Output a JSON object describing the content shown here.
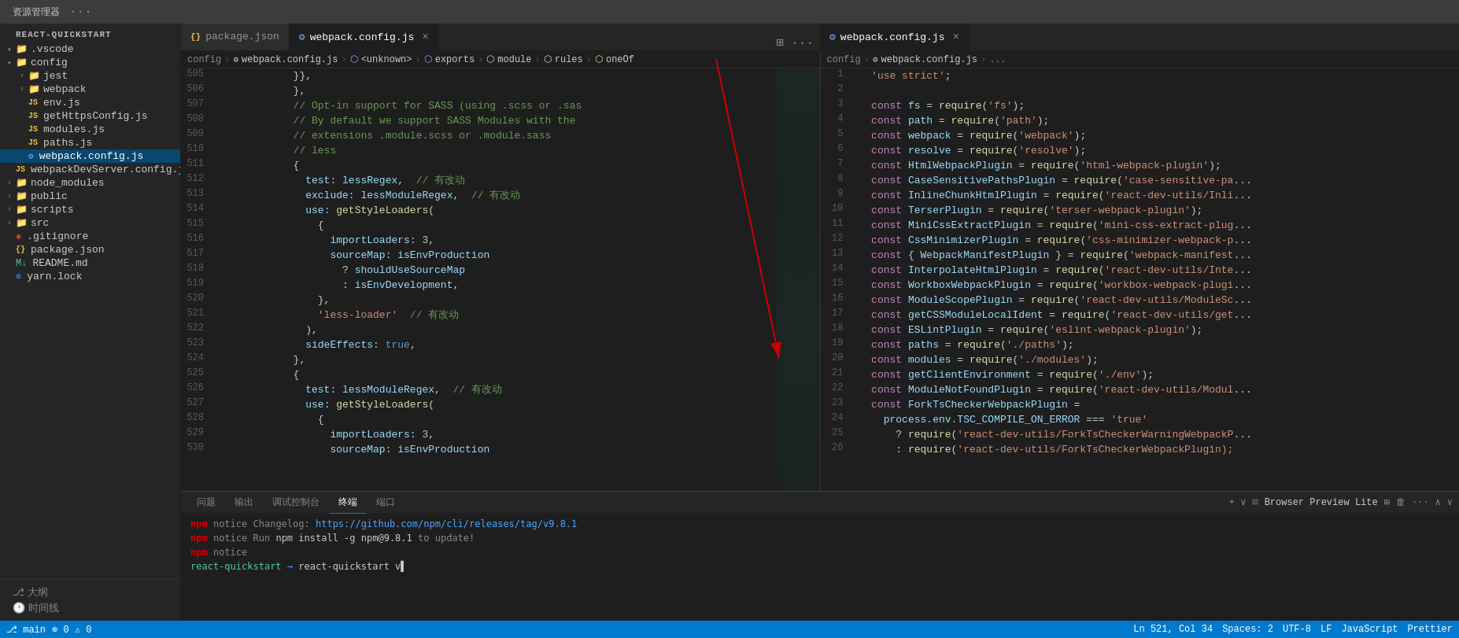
{
  "titlebar": {
    "title": "资源管理器",
    "dots": "···"
  },
  "tabs_left": [
    {
      "id": "package-json",
      "label": "package.json",
      "icon": "js",
      "active": false,
      "closable": false
    },
    {
      "id": "webpack-config",
      "label": "webpack.config.js",
      "icon": "webpack",
      "active": true,
      "closable": true
    }
  ],
  "tabs_right": [
    {
      "id": "webpack-config-right",
      "label": "webpack.config.js",
      "icon": "webpack",
      "active": true,
      "closable": true
    }
  ],
  "breadcrumb_left": {
    "parts": [
      "config",
      "webpack.config.js",
      "<unknown>",
      "exports",
      "module",
      "rules",
      "oneOf"
    ]
  },
  "breadcrumb_right": {
    "parts": [
      "config",
      "webpack.config.js",
      "..."
    ]
  },
  "sidebar": {
    "title": "REACT-QUICKSTART",
    "tree": [
      {
        "indent": 0,
        "arrow": "▾",
        "icon": "folder",
        "label": ".vscode"
      },
      {
        "indent": 0,
        "arrow": "▾",
        "icon": "folder",
        "label": "config",
        "open": true
      },
      {
        "indent": 1,
        "arrow": "›",
        "icon": "folder",
        "label": "jest"
      },
      {
        "indent": 1,
        "arrow": "›",
        "icon": "folder",
        "label": "webpack"
      },
      {
        "indent": 1,
        "arrow": "",
        "icon": "js",
        "label": "env.js"
      },
      {
        "indent": 1,
        "arrow": "",
        "icon": "js",
        "label": "getHttpsConfig.js"
      },
      {
        "indent": 1,
        "arrow": "",
        "icon": "js",
        "label": "modules.js"
      },
      {
        "indent": 1,
        "arrow": "",
        "icon": "js",
        "label": "paths.js"
      },
      {
        "indent": 1,
        "arrow": "",
        "icon": "webpack",
        "label": "webpack.config.js",
        "selected": true
      },
      {
        "indent": 1,
        "arrow": "",
        "icon": "js",
        "label": "webpackDevServer.config.js"
      },
      {
        "indent": 0,
        "arrow": "›",
        "icon": "folder",
        "label": "node_modules"
      },
      {
        "indent": 0,
        "arrow": "›",
        "icon": "folder",
        "label": "public"
      },
      {
        "indent": 0,
        "arrow": "›",
        "icon": "folder",
        "label": "scripts"
      },
      {
        "indent": 0,
        "arrow": "›",
        "icon": "folder",
        "label": "src"
      },
      {
        "indent": 0,
        "arrow": "",
        "icon": "git",
        "label": ".gitignore"
      },
      {
        "indent": 0,
        "arrow": "",
        "icon": "json",
        "label": "package.json"
      },
      {
        "indent": 0,
        "arrow": "",
        "icon": "md",
        "label": "README.md"
      },
      {
        "indent": 0,
        "arrow": "",
        "icon": "yarn",
        "label": "yarn.lock"
      }
    ]
  },
  "code_left": {
    "lines": [
      {
        "num": 505,
        "code": "            }},",
        "color": "default"
      },
      {
        "num": 506,
        "code": "            },",
        "color": "default"
      },
      {
        "num": 507,
        "code": "            // Opt-in support for SASS (using .scss or .sas",
        "color": "comment"
      },
      {
        "num": 508,
        "code": "            // By default we support SASS Modules with the",
        "color": "comment"
      },
      {
        "num": 509,
        "code": "            // extensions .module.scss or .module.sass",
        "color": "comment"
      },
      {
        "num": 510,
        "code": "            // less",
        "color": "comment"
      },
      {
        "num": 511,
        "code": "            {",
        "color": "default"
      },
      {
        "num": 512,
        "code": "              test: lessRegex,  // 有改动",
        "color": "changed"
      },
      {
        "num": 513,
        "code": "              exclude: lessModuleRegex,  // 有改动",
        "color": "changed"
      },
      {
        "num": 514,
        "code": "              use: getStyleLoaders(",
        "color": "default"
      },
      {
        "num": 515,
        "code": "                {",
        "color": "default"
      },
      {
        "num": 516,
        "code": "                  importLoaders: 3,",
        "color": "default"
      },
      {
        "num": 517,
        "code": "                  sourceMap: isEnvProduction",
        "color": "default"
      },
      {
        "num": 518,
        "code": "                    ? shouldUseSourceMap",
        "color": "default"
      },
      {
        "num": 519,
        "code": "                    : isEnvDevelopment,",
        "color": "default"
      },
      {
        "num": 520,
        "code": "                },",
        "color": "default"
      },
      {
        "num": 521,
        "code": "                'less-loader'  // 有改动",
        "color": "changed"
      },
      {
        "num": 522,
        "code": "              ),",
        "color": "default"
      },
      {
        "num": 523,
        "code": "              sideEffects: true,",
        "color": "default"
      },
      {
        "num": 524,
        "code": "            },",
        "color": "default"
      },
      {
        "num": 525,
        "code": "            {",
        "color": "default"
      },
      {
        "num": 526,
        "code": "              test: lessModuleRegex,  // 有改动",
        "color": "changed"
      },
      {
        "num": 527,
        "code": "              use: getStyleLoaders(",
        "color": "default"
      },
      {
        "num": 528,
        "code": "                {",
        "color": "default"
      },
      {
        "num": 529,
        "code": "                  importLoaders: 3,",
        "color": "default"
      },
      {
        "num": 530,
        "code": "                  sourceMap: isEnvProduction",
        "color": "default"
      }
    ]
  },
  "code_right": {
    "lines": [
      {
        "num": 1,
        "code": "  'use strict';"
      },
      {
        "num": 2,
        "code": ""
      },
      {
        "num": 3,
        "code": "  const fs = require('fs');"
      },
      {
        "num": 4,
        "code": "  const path = require('path');"
      },
      {
        "num": 5,
        "code": "  const webpack = require('webpack');"
      },
      {
        "num": 6,
        "code": "  const resolve = require('resolve');"
      },
      {
        "num": 7,
        "code": "  const HtmlWebpackPlugin = require('html-webpack-plugin');"
      },
      {
        "num": 8,
        "code": "  const CaseSensitivePathsPlugin = require('case-sensitive-pa"
      },
      {
        "num": 9,
        "code": "  const InlineChunkHtmlPlugin = require('react-dev-utils/Inli"
      },
      {
        "num": 10,
        "code": "  const TerserPlugin = require('terser-webpack-plugin');"
      },
      {
        "num": 11,
        "code": "  const MiniCssExtractPlugin = require('mini-css-extract-plug"
      },
      {
        "num": 12,
        "code": "  const CssMinimizerPlugin = require('css-minimizer-webpack-p"
      },
      {
        "num": 13,
        "code": "  const { WebpackManifestPlugin } = require('webpack-manifest"
      },
      {
        "num": 14,
        "code": "  const InterpolateHtmlPlugin = require('react-dev-utils/Inte"
      },
      {
        "num": 15,
        "code": "  const WorkboxWebpackPlugin = require('workbox-webpack-plugi"
      },
      {
        "num": 16,
        "code": "  const ModuleScopePlugin = require('react-dev-utils/ModuleSc"
      },
      {
        "num": 17,
        "code": "  const getCSSModuleLocalIdent = require('react-dev-utils/get"
      },
      {
        "num": 18,
        "code": "  const ESLintPlugin = require('eslint-webpack-plugin');"
      },
      {
        "num": 19,
        "code": "  const paths = require('./paths');"
      },
      {
        "num": 20,
        "code": "  const modules = require('./modules');"
      },
      {
        "num": 21,
        "code": "  const getClientEnvironment = require('./env');"
      },
      {
        "num": 22,
        "code": "  const ModuleNotFoundPlugin = require('react-dev-utils/Modul"
      },
      {
        "num": 23,
        "code": "  const ForkTsCheckerWebpackPlugin ="
      },
      {
        "num": 24,
        "code": "    process.env.TSC_COMPILE_ON_ERROR === 'true'"
      },
      {
        "num": 25,
        "code": "      ? require('react-dev-utils/ForkTsCheckerWarningWebpackP"
      },
      {
        "num": 26,
        "code": "      : require('react-dev-utils/ForkTsCheckerWebpackPlugin);"
      }
    ]
  },
  "panel": {
    "tabs": [
      "问题",
      "输出",
      "调试控制台",
      "终端",
      "端口"
    ],
    "active_tab": "终端",
    "terminal_lines": [
      {
        "type": "npm-notice",
        "text": "npm notice Changelog: https://github.com/npm/cli/releases/tag/v9.8.1"
      },
      {
        "type": "npm-notice",
        "text": "npm notice Run npm install -g npm@9.8.1 to update!"
      },
      {
        "type": "npm-notice",
        "text": "npm notice"
      }
    ],
    "prompt": "react-quickstart",
    "right_actions": [
      "+ ∨",
      "⊡",
      "Browser Preview Lite",
      "⊞",
      "🗑",
      "···",
      "∧",
      "∨"
    ]
  },
  "statusbar": {
    "left": [
      "⎇ 大纲",
      "时间线"
    ],
    "right": [
      "Ln 521, Col 34",
      "Spaces: 2",
      "UTF-8",
      "LF",
      "JavaScript",
      "Prettier"
    ]
  }
}
